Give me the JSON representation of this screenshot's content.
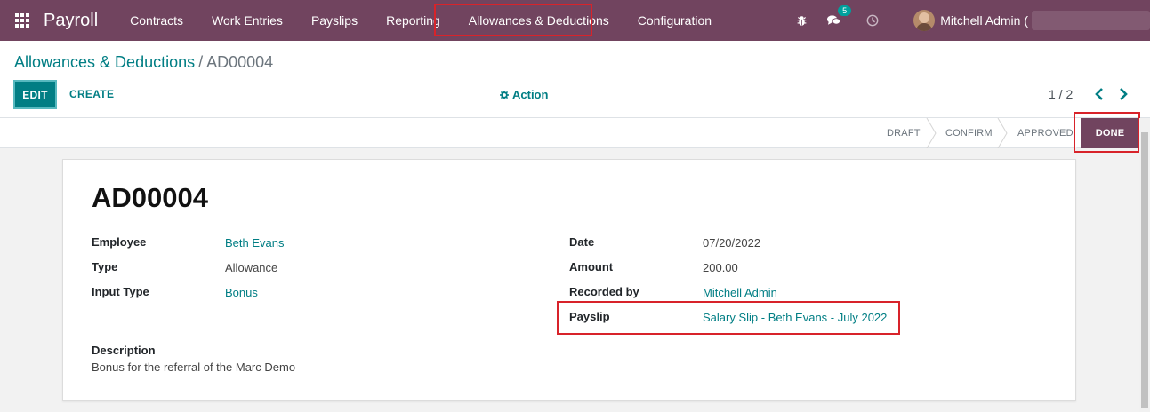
{
  "navbar": {
    "app_title": "Payroll",
    "menu": [
      {
        "label": "Contracts"
      },
      {
        "label": "Work Entries"
      },
      {
        "label": "Payslips"
      },
      {
        "label": "Reporting"
      },
      {
        "label": "Allowances & Deductions"
      },
      {
        "label": "Configuration"
      }
    ],
    "messages_count": "5",
    "user_name": "Mitchell Admin (",
    "icons": [
      "apps-grid-icon",
      "bug-icon",
      "chat-icon",
      "clock-icon"
    ]
  },
  "breadcrumb": {
    "parent": "Allowances & Deductions",
    "separator": "/",
    "current": "AD00004"
  },
  "toolbar": {
    "edit_label": "EDIT",
    "create_label": "CREATE",
    "action_label": "Action"
  },
  "pager": {
    "value": "1 / 2"
  },
  "status": {
    "stages": [
      "DRAFT",
      "CONFIRM",
      "APPROVED",
      "DONE"
    ],
    "current": "DONE"
  },
  "record": {
    "title": "AD00004",
    "left_fields": [
      {
        "label": "Employee",
        "value": "Beth Evans"
      },
      {
        "label": "Type",
        "value": "Allowance"
      },
      {
        "label": "Input Type",
        "value": "Bonus"
      }
    ],
    "right_fields": [
      {
        "label": "Date",
        "value": "07/20/2022"
      },
      {
        "label": "Amount",
        "value": "200.00"
      },
      {
        "label": "Recorded by",
        "value": "Mitchell Admin"
      },
      {
        "label": "Payslip",
        "value": "Salary Slip - Beth Evans - July 2022"
      }
    ],
    "description_label": "Description",
    "description": "Bonus for the referral of the Marc Demo"
  },
  "colors": {
    "navbar": "#71445f",
    "accent": "#017e84",
    "highlight_box": "#d8232a"
  }
}
